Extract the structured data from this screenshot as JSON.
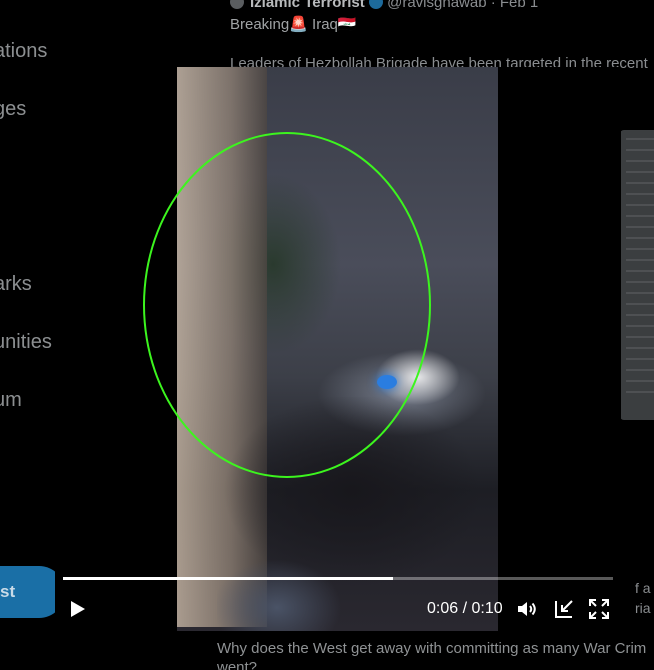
{
  "sidebar": {
    "items": [
      {
        "label": "ations"
      },
      {
        "label": "ges"
      },
      {
        "label": "arks"
      },
      {
        "label": "unities"
      },
      {
        "label": "um"
      }
    ],
    "post_label": "st"
  },
  "tweet": {
    "author": "Izlamic Terrorist",
    "handle_and_date": "@ravisghawab · Feb 1",
    "line1": "Breaking🚨 Iraq🇮🇶",
    "text": "Leaders of Hezbollah Brigade have been targeted in the recent",
    "right_a": "f a c",
    "right_b": "ria a",
    "bottom_line1": "Why does the West get away with committing as many War Crim",
    "bottom_line2": "went?"
  },
  "video": {
    "time_display": "0:06 / 0:10",
    "progress": 0.6,
    "annotation_color": "#3cf51e"
  },
  "icons": {
    "play": "play-icon",
    "volume": "volume-icon",
    "minimize": "minimize-icon",
    "fullscreen": "fullscreen-icon"
  }
}
